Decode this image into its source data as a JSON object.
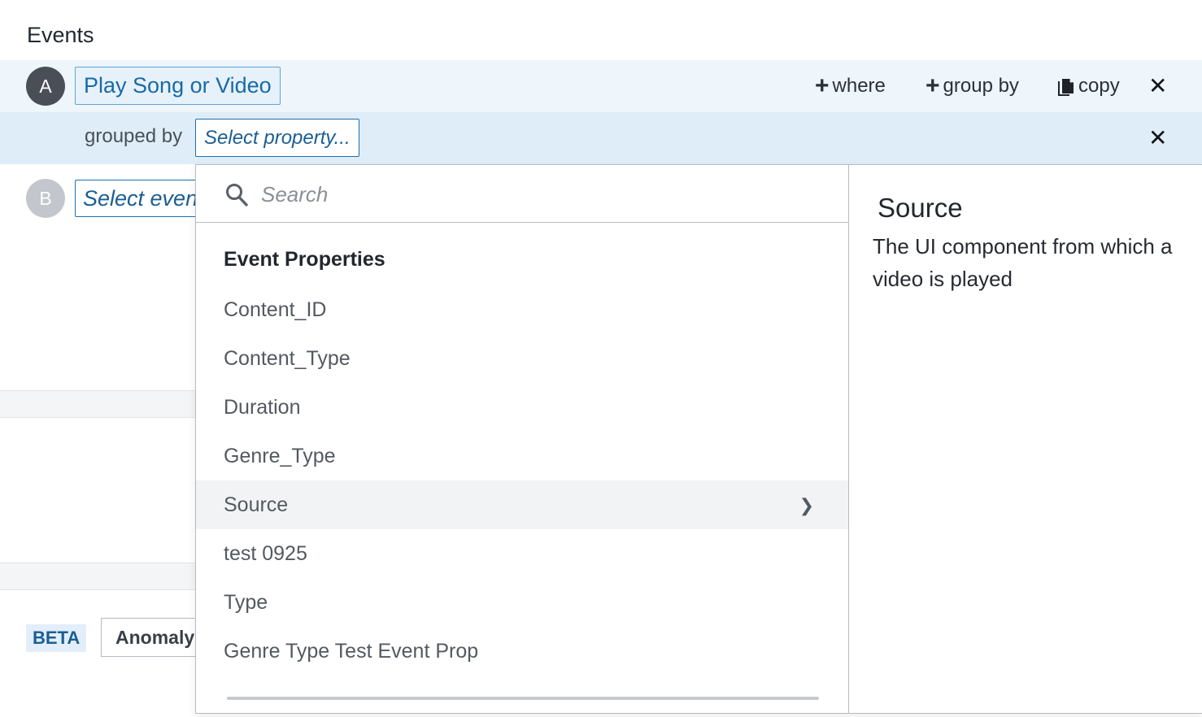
{
  "section": {
    "title": "Events"
  },
  "event_a": {
    "badge": "A",
    "name": "Play Song or Video"
  },
  "actions": {
    "where": "where",
    "group_by": "group by",
    "copy": "copy"
  },
  "group_row": {
    "label": "grouped by",
    "select_placeholder": "Select property..."
  },
  "event_b": {
    "badge": "B",
    "select_placeholder": "Select event"
  },
  "footer": {
    "beta": "BETA",
    "anomaly": "Anomaly"
  },
  "dropdown": {
    "search_placeholder": "Search",
    "group_heading": "Event Properties",
    "items": [
      {
        "label": "Content_ID"
      },
      {
        "label": "Content_Type"
      },
      {
        "label": "Duration"
      },
      {
        "label": "Genre_Type"
      },
      {
        "label": "Source",
        "active": true
      },
      {
        "label": "test 0925"
      },
      {
        "label": "Type"
      },
      {
        "label": "Genre Type Test Event Prop"
      }
    ],
    "detail": {
      "title": "Source",
      "description": "The UI component from which a video is played"
    }
  },
  "icons": {
    "plus": "plus-icon",
    "copy": "copy-icon",
    "close": "close-icon",
    "search": "search-icon",
    "chevron": "chevron-right-icon"
  },
  "colors": {
    "row_highlight": "#eef5fb",
    "group_row": "#dfedf8",
    "accent": "#1a6aa6",
    "badge_active": "#4a4f57",
    "badge_inactive": "#c3c7cd"
  }
}
